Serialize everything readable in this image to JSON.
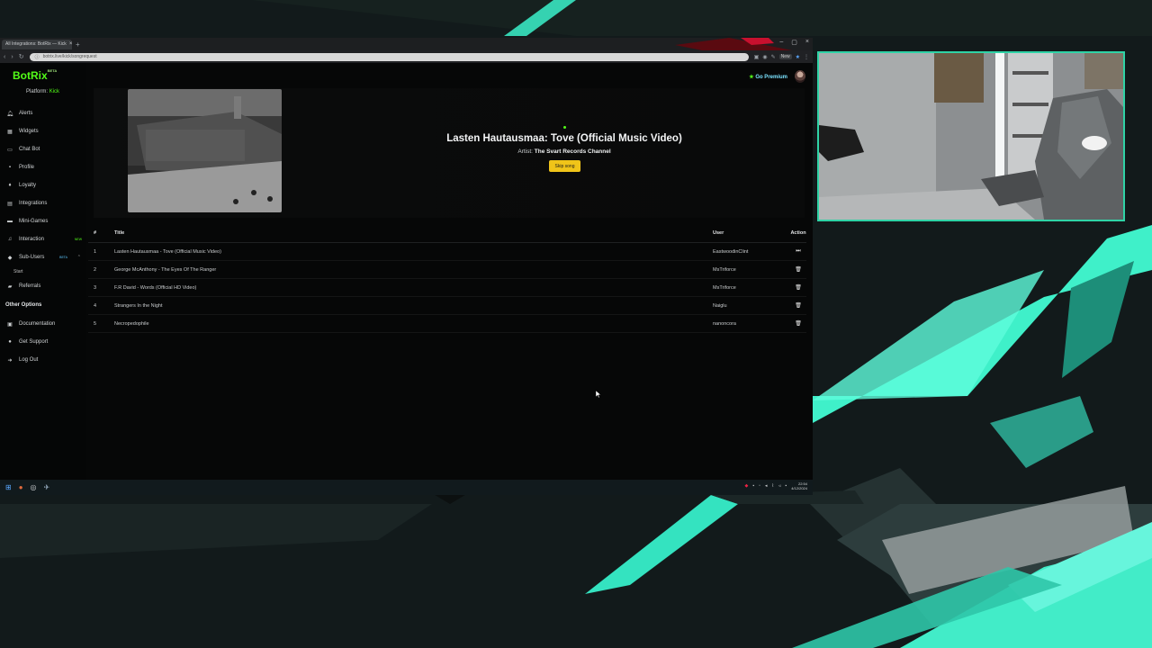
{
  "browser": {
    "tab_title": "All Integrations: BotRix — Kick",
    "tab_close": "×",
    "new_tab": "+",
    "url": "botrix.live/kick/songrequest",
    "extensions_badge": "New",
    "window_controls": [
      "–",
      "▢",
      "×"
    ]
  },
  "sidebar": {
    "brand": "BotRix",
    "brand_badge": "BETA",
    "platform_label": "Platform:",
    "platform_value": "Kick",
    "items": [
      {
        "label": "Alerts",
        "icon": "bell-icon"
      },
      {
        "label": "Widgets",
        "icon": "widgets-icon"
      },
      {
        "label": "Chat Bot",
        "icon": "chat-icon"
      },
      {
        "label": "Profile",
        "icon": "profile-icon"
      },
      {
        "label": "Loyalty",
        "icon": "loyalty-icon"
      },
      {
        "label": "Integrations",
        "icon": "integrations-icon"
      },
      {
        "label": "Mini-Games",
        "icon": "gamepad-icon"
      },
      {
        "label": "Interaction",
        "icon": "music-icon",
        "tag": "NEW"
      },
      {
        "label": "Sub-Users",
        "icon": "users-icon",
        "tag": "BETA"
      }
    ],
    "sub_item": "Start",
    "other_heading": "Other Options",
    "other_items": [
      {
        "label": "Referrals",
        "icon": "referral-icon"
      },
      {
        "label": "Documentation",
        "icon": "docs-icon"
      },
      {
        "label": "Get Support",
        "icon": "support-icon"
      },
      {
        "label": "Log Out",
        "icon": "logout-icon"
      }
    ]
  },
  "header": {
    "premium_label": "Go Premium"
  },
  "now_playing": {
    "title": "Lasten Hautausmaa: Tove (Official Music Video)",
    "artist_label": "Artist:",
    "artist_name": "The Svart Records Channel",
    "skip_label": "Skip song"
  },
  "queue": {
    "columns": [
      "#",
      "Title",
      "User",
      "Action"
    ],
    "rows": [
      {
        "num": "1",
        "title": "Lasten Hautausmaa - Tove (Official Music Video)",
        "user": "EastwoodinClint",
        "action": "play-next-icon"
      },
      {
        "num": "2",
        "title": "George McAnthony - The Eyes Of The Ranger",
        "user": "MsTriforce",
        "action": "trash-icon"
      },
      {
        "num": "3",
        "title": "F.R David - Words (Official HD Video)",
        "user": "MsTriforce",
        "action": "trash-icon"
      },
      {
        "num": "4",
        "title": "Strangers In the Night",
        "user": "Naiglu",
        "action": "trash-icon"
      },
      {
        "num": "5",
        "title": "Necropedophile",
        "user": "nanoncora",
        "action": "trash-icon"
      }
    ]
  },
  "taskbar": {
    "clock_time": "22:54",
    "clock_date": "4/12/2024"
  },
  "colors": {
    "accent_green": "#53fc18",
    "webcam_border": "#2fd3a6",
    "skip_button": "#f0c419"
  }
}
